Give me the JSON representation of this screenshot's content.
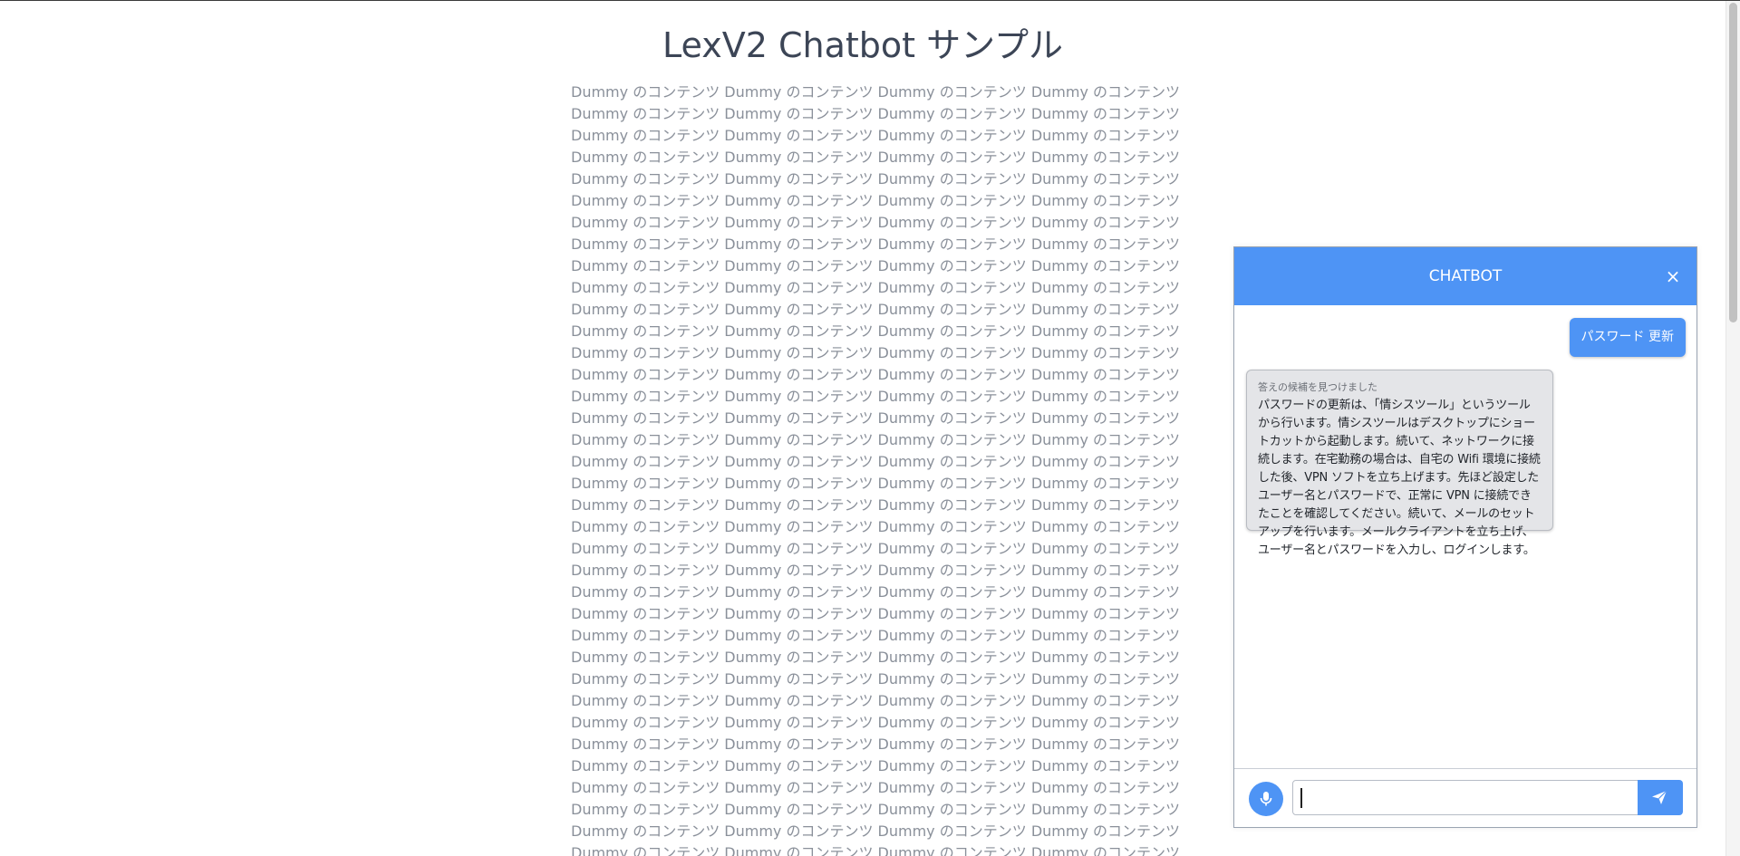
{
  "page": {
    "title": "LexV2 Chatbot サンプル",
    "dummy_text": "Dummy のコンテンツ Dummy のコンテンツ Dummy のコンテンツ Dummy のコンテンツ"
  },
  "chatbot": {
    "header_title": "CHATBOT",
    "close_label": "×",
    "messages": [
      {
        "role": "user",
        "text": "パスワード 更新"
      },
      {
        "role": "bot",
        "caption": "答えの候補を見つけました",
        "text": "パスワードの更新は、「情シスツール」というツールから行います。情シスツールはデスクトップにショートカットから起動します。続いて、ネットワークに接続します。在宅勤務の場合は、自宅の Wifi 環境に接続した後、VPN ソフトを立ち上げます。先ほど設定したユーザー名とパスワードで、正常に VPN に接続できたことを確認してください。続いて、メールのセットアップを行います。メールクライアントを立ち上げ、ユーザー名とパスワードを入力し、ログインします。"
      }
    ],
    "input": {
      "value": "",
      "placeholder": ""
    },
    "icons": {
      "mic": "microphone-icon",
      "send": "send-icon",
      "close": "close-icon"
    },
    "colors": {
      "accent": "#4e94f5",
      "bot_bubble": "#e4e5e8"
    }
  }
}
